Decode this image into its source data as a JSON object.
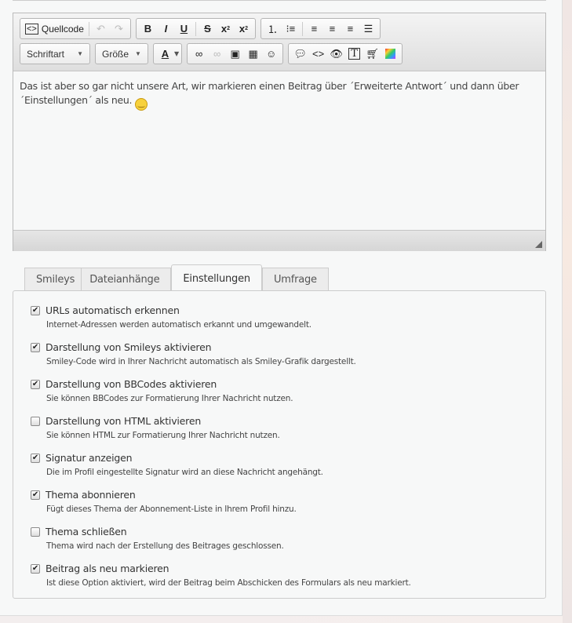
{
  "toolbar": {
    "source": "Quellcode",
    "font": "Schriftart",
    "size": "Größe"
  },
  "editor": {
    "text": "Das ist aber so gar nicht unsere Art, wir markieren einen Beitrag über ´Erweiterte Antwort´ und dann über ´Einstellungen´ als neu."
  },
  "tabs": [
    {
      "label": "Smileys"
    },
    {
      "label": "Dateianhänge"
    },
    {
      "label": "Einstellungen"
    },
    {
      "label": "Umfrage"
    }
  ],
  "options": [
    {
      "label": "URLs automatisch erkennen",
      "desc": "Internet-Adressen werden automatisch erkannt und umgewandelt.",
      "checked": true
    },
    {
      "label": "Darstellung von Smileys aktivieren",
      "desc": "Smiley-Code wird in Ihrer Nachricht automatisch als Smiley-Grafik dargestellt.",
      "checked": true
    },
    {
      "label": "Darstellung von BBCodes aktivieren",
      "desc": "Sie können BBCodes zur Formatierung Ihrer Nachricht nutzen.",
      "checked": true
    },
    {
      "label": "Darstellung von HTML aktivieren",
      "desc": "Sie können HTML zur Formatierung Ihrer Nachricht nutzen.",
      "checked": false
    },
    {
      "label": "Signatur anzeigen",
      "desc": "Die im Profil eingestellte Signatur wird an diese Nachricht angehängt.",
      "checked": true
    },
    {
      "label": "Thema abonnieren",
      "desc": "Fügt dieses Thema der Abonnement-Liste in Ihrem Profil hinzu.",
      "checked": true
    },
    {
      "label": "Thema schließen",
      "desc": "Thema wird nach der Erstellung des Beitrages geschlossen.",
      "checked": false
    },
    {
      "label": "Beitrag als neu markieren",
      "desc": "Ist diese Option aktiviert, wird der Beitrag beim Abschicken des Formulars als neu markiert.",
      "checked": true
    }
  ]
}
